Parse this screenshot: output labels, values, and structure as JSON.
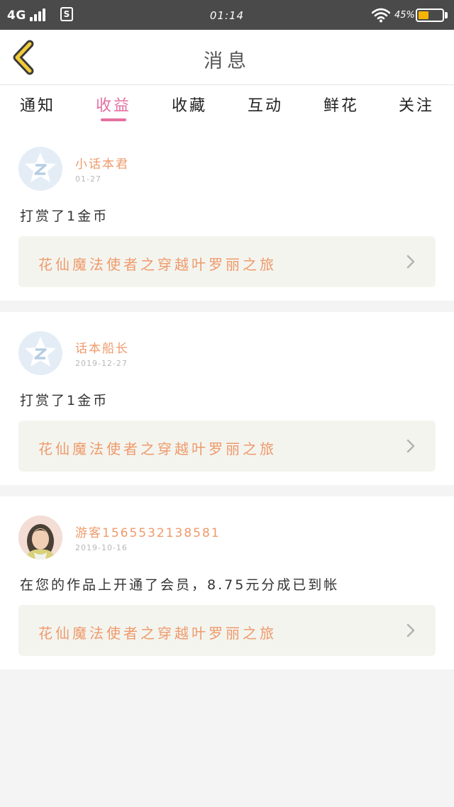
{
  "status_bar": {
    "network": "4G",
    "time": "01:14",
    "battery_percent": "45%",
    "battery_level": 0.45,
    "battery_color": "#f4b400"
  },
  "header": {
    "title": "消息",
    "back_icon": "chevron-left-icon"
  },
  "tabs": [
    {
      "label": "通知"
    },
    {
      "label": "收益"
    },
    {
      "label": "收藏"
    },
    {
      "label": "互动"
    },
    {
      "label": "鲜花"
    },
    {
      "label": "关注"
    }
  ],
  "active_tab": "收益",
  "accent_color": "#e56fa0",
  "name_color": "#ee9a6a",
  "messages": [
    {
      "sender": "小话本君",
      "date": "01-27",
      "avatar": "qq-avatar-icon",
      "text": "打赏了1金币",
      "work_title": "花仙魔法使者之穿越叶罗丽之旅"
    },
    {
      "sender": "话本船长",
      "date": "2019-12-27",
      "avatar": "qq-avatar-icon",
      "text": "打赏了1金币",
      "work_title": "花仙魔法使者之穿越叶罗丽之旅"
    },
    {
      "sender": "游客1565532138581",
      "date": "2019-10-16",
      "avatar": "user-photo",
      "text": "在您的作品上开通了会员，8.75元分成已到帐",
      "work_title": "花仙魔法使者之穿越叶罗丽之旅"
    }
  ]
}
